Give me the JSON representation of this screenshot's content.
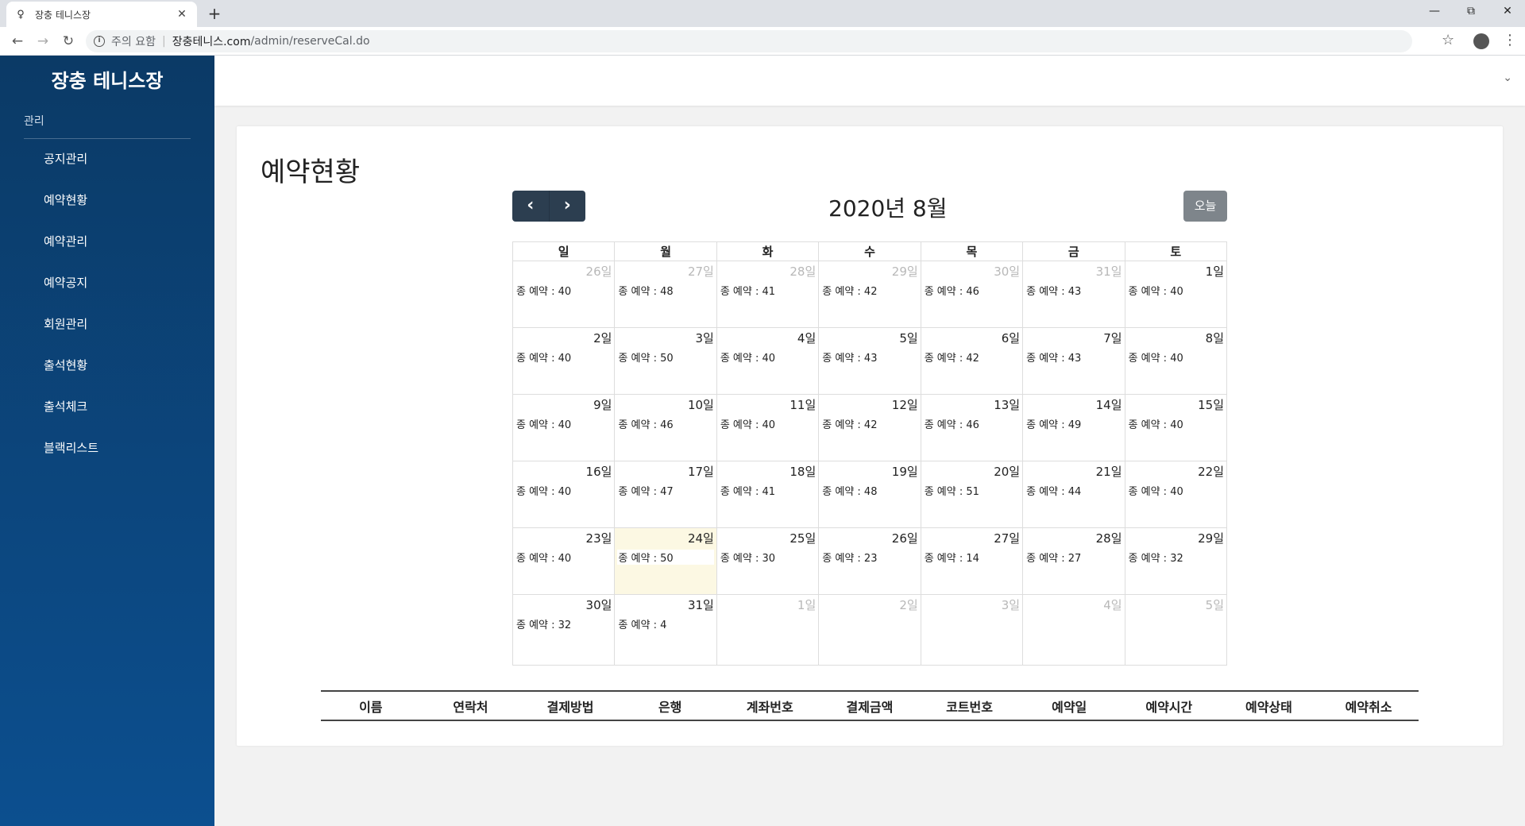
{
  "browser": {
    "tab_title": "장충 테니스장",
    "security_text": "주의 요함",
    "url_host": "장충테니스.com",
    "url_path": "/admin/reserveCal.do"
  },
  "sidebar": {
    "brand": "장충 테니스장",
    "section_label": "관리",
    "items": [
      {
        "label": "공지관리"
      },
      {
        "label": "예약현황"
      },
      {
        "label": "예약관리"
      },
      {
        "label": "예약공지"
      },
      {
        "label": "회원관리"
      },
      {
        "label": "출석현황"
      },
      {
        "label": "출석체크"
      },
      {
        "label": "블랙리스트"
      }
    ]
  },
  "page": {
    "title": "예약현황",
    "calendar_title": "2020년 8월",
    "today_button": "오늘",
    "prev_icon": "chevron-left-icon",
    "next_icon": "chevron-right-icon"
  },
  "calendar": {
    "weekdays": [
      "일",
      "월",
      "화",
      "수",
      "목",
      "금",
      "토"
    ],
    "today_highlight": "#fcf8e3",
    "weeks": [
      [
        {
          "day": "26일",
          "other": true,
          "event": "종 예약 : 40"
        },
        {
          "day": "27일",
          "other": true,
          "event": "종 예약 : 48"
        },
        {
          "day": "28일",
          "other": true,
          "event": "종 예약 : 41"
        },
        {
          "day": "29일",
          "other": true,
          "event": "종 예약 : 42"
        },
        {
          "day": "30일",
          "other": true,
          "event": "종 예약 : 46"
        },
        {
          "day": "31일",
          "other": true,
          "event": "종 예약 : 43"
        },
        {
          "day": "1일",
          "other": false,
          "event": "종 예약 : 40"
        }
      ],
      [
        {
          "day": "2일",
          "other": false,
          "event": "종 예약 : 40"
        },
        {
          "day": "3일",
          "other": false,
          "event": "종 예약 : 50"
        },
        {
          "day": "4일",
          "other": false,
          "event": "종 예약 : 40"
        },
        {
          "day": "5일",
          "other": false,
          "event": "종 예약 : 43"
        },
        {
          "day": "6일",
          "other": false,
          "event": "종 예약 : 42"
        },
        {
          "day": "7일",
          "other": false,
          "event": "종 예약 : 43"
        },
        {
          "day": "8일",
          "other": false,
          "event": "종 예약 : 40"
        }
      ],
      [
        {
          "day": "9일",
          "other": false,
          "event": "종 예약 : 40"
        },
        {
          "day": "10일",
          "other": false,
          "event": "종 예약 : 46"
        },
        {
          "day": "11일",
          "other": false,
          "event": "종 예약 : 40"
        },
        {
          "day": "12일",
          "other": false,
          "event": "종 예약 : 42"
        },
        {
          "day": "13일",
          "other": false,
          "event": "종 예약 : 46"
        },
        {
          "day": "14일",
          "other": false,
          "event": "종 예약 : 49"
        },
        {
          "day": "15일",
          "other": false,
          "event": "종 예약 : 40"
        }
      ],
      [
        {
          "day": "16일",
          "other": false,
          "event": "종 예약 : 40"
        },
        {
          "day": "17일",
          "other": false,
          "event": "종 예약 : 47"
        },
        {
          "day": "18일",
          "other": false,
          "event": "종 예약 : 41"
        },
        {
          "day": "19일",
          "other": false,
          "event": "종 예약 : 48"
        },
        {
          "day": "20일",
          "other": false,
          "event": "종 예약 : 51"
        },
        {
          "day": "21일",
          "other": false,
          "event": "종 예약 : 44"
        },
        {
          "day": "22일",
          "other": false,
          "event": "종 예약 : 40"
        }
      ],
      [
        {
          "day": "23일",
          "other": false,
          "event": "종 예약 : 40"
        },
        {
          "day": "24일",
          "other": false,
          "today": true,
          "event": "종 예약 : 50"
        },
        {
          "day": "25일",
          "other": false,
          "event": "종 예약 : 30"
        },
        {
          "day": "26일",
          "other": false,
          "event": "종 예약 : 23"
        },
        {
          "day": "27일",
          "other": false,
          "event": "종 예약 : 14"
        },
        {
          "day": "28일",
          "other": false,
          "event": "종 예약 : 27"
        },
        {
          "day": "29일",
          "other": false,
          "event": "종 예약 : 32"
        }
      ],
      [
        {
          "day": "30일",
          "other": false,
          "event": "종 예약 : 32"
        },
        {
          "day": "31일",
          "other": false,
          "event": "종 예약 : 4"
        },
        {
          "day": "1일",
          "other": true,
          "event": ""
        },
        {
          "day": "2일",
          "other": true,
          "event": ""
        },
        {
          "day": "3일",
          "other": true,
          "event": ""
        },
        {
          "day": "4일",
          "other": true,
          "event": ""
        },
        {
          "day": "5일",
          "other": true,
          "event": ""
        }
      ]
    ]
  },
  "reservation_table": {
    "columns": [
      "이름",
      "연락처",
      "결제방법",
      "은행",
      "계좌번호",
      "결제금액",
      "코트번호",
      "예약일",
      "예약시간",
      "예약상태",
      "예약취소"
    ]
  }
}
